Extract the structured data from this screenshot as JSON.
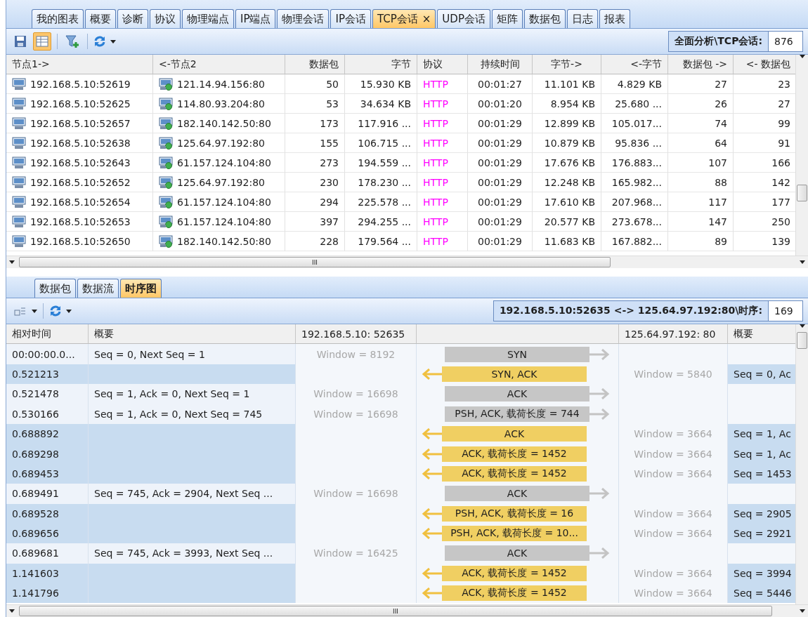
{
  "top_tabs": [
    {
      "label": "我的图表",
      "selected": false
    },
    {
      "label": "概要",
      "selected": false
    },
    {
      "label": "诊断",
      "selected": false
    },
    {
      "label": "协议",
      "selected": false
    },
    {
      "label": "物理端点",
      "selected": false
    },
    {
      "label": "IP端点",
      "selected": false
    },
    {
      "label": "物理会话",
      "selected": false
    },
    {
      "label": "IP会话",
      "selected": false
    },
    {
      "label": "TCP会话",
      "selected": true,
      "close": "×"
    },
    {
      "label": "UDP会话",
      "selected": false
    },
    {
      "label": "矩阵",
      "selected": false
    },
    {
      "label": "数据包",
      "selected": false
    },
    {
      "label": "日志",
      "selected": false
    },
    {
      "label": "报表",
      "selected": false
    }
  ],
  "toolbar": {
    "path_label": "全面分析\\TCP会话:",
    "count": "876"
  },
  "table": {
    "columns": [
      "节点1->",
      "<-节点2",
      "数据包",
      "字节",
      "协议",
      "持续时间",
      "字节->",
      "<-字节",
      "数据包 ->",
      "<- 数据包"
    ],
    "rows": [
      [
        "192.168.5.10:52619",
        "121.14.94.156:80",
        "50",
        "15.930 KB",
        "HTTP",
        "00:01:27",
        "11.101 KB",
        "4.829 KB",
        "27",
        "23"
      ],
      [
        "192.168.5.10:52625",
        "114.80.93.204:80",
        "53",
        "34.634 KB",
        "HTTP",
        "00:01:20",
        "8.954 KB",
        "25.680 ...",
        "26",
        "27"
      ],
      [
        "192.168.5.10:52657",
        "182.140.142.50:80",
        "173",
        "117.916 ...",
        "HTTP",
        "00:01:29",
        "12.899 KB",
        "105.017...",
        "74",
        "99"
      ],
      [
        "192.168.5.10:52638",
        "125.64.97.192:80",
        "155",
        "106.715 ...",
        "HTTP",
        "00:01:29",
        "10.879 KB",
        "95.836 ...",
        "64",
        "91"
      ],
      [
        "192.168.5.10:52643",
        "61.157.124.104:80",
        "273",
        "194.559 ...",
        "HTTP",
        "00:01:29",
        "17.676 KB",
        "176.883...",
        "107",
        "166"
      ],
      [
        "192.168.5.10:52652",
        "125.64.97.192:80",
        "230",
        "178.230 ...",
        "HTTP",
        "00:01:29",
        "12.248 KB",
        "165.982...",
        "88",
        "142"
      ],
      [
        "192.168.5.10:52654",
        "61.157.124.104:80",
        "294",
        "225.578 ...",
        "HTTP",
        "00:01:29",
        "17.610 KB",
        "207.968...",
        "117",
        "177"
      ],
      [
        "192.168.5.10:52653",
        "61.157.124.104:80",
        "397",
        "294.255 ...",
        "HTTP",
        "00:01:29",
        "20.577 KB",
        "273.678...",
        "147",
        "250"
      ],
      [
        "192.168.5.10:52650",
        "182.140.142.50:80",
        "228",
        "179.564 ...",
        "HTTP",
        "00:01:29",
        "11.683 KB",
        "167.882...",
        "89",
        "139"
      ]
    ]
  },
  "bottom_tabs": [
    {
      "label": "数据包",
      "selected": false
    },
    {
      "label": "数据流",
      "selected": false
    },
    {
      "label": "时序图",
      "selected": true
    }
  ],
  "sequence": {
    "path_label": "192.168.5.10:52635 <-> 125.64.97.192:80\\时序:",
    "count": "169",
    "columns": [
      "相对时间",
      "概要",
      "192.168.5.10: 52635",
      "125.64.97.192: 80",
      "概要"
    ],
    "rows": [
      {
        "kind": "out",
        "time": "00:00:00.0...",
        "summary": "Seq = 0, Next Seq = 1",
        "window": "Window = 8192",
        "packet": "SYN"
      },
      {
        "kind": "in",
        "time": "0.521213",
        "summary": "Seq = 0, Ac",
        "window": "Window = 5840",
        "packet": "SYN, ACK"
      },
      {
        "kind": "out",
        "time": "0.521478",
        "summary": "Seq = 1, Ack = 0, Next Seq = 1",
        "window": "Window = 16698",
        "packet": "ACK"
      },
      {
        "kind": "out",
        "time": "0.530166",
        "summary": "Seq = 1, Ack = 0, Next Seq = 745",
        "window": "Window = 16698",
        "packet": "PSH, ACK, 载荷长度 = 744"
      },
      {
        "kind": "in",
        "time": "0.688892",
        "summary": "Seq = 1, Ac",
        "window": "Window = 3664",
        "packet": "ACK"
      },
      {
        "kind": "in",
        "time": "0.689298",
        "summary": "Seq = 1, Ac",
        "window": "Window = 3664",
        "packet": "ACK, 载荷长度 = 1452"
      },
      {
        "kind": "in",
        "time": "0.689453",
        "summary": "Seq = 1453",
        "window": "Window = 3664",
        "packet": "ACK, 载荷长度 = 1452"
      },
      {
        "kind": "out",
        "time": "0.689491",
        "summary": "Seq = 745, Ack = 2904, Next Seq ...",
        "window": "Window = 16698",
        "packet": "ACK"
      },
      {
        "kind": "in",
        "time": "0.689528",
        "summary": "Seq = 2905",
        "window": "Window = 3664",
        "packet": "PSH, ACK, 载荷长度 = 16"
      },
      {
        "kind": "in",
        "time": "0.689656",
        "summary": "Seq = 2921",
        "window": "Window = 3664",
        "packet": "PSH, ACK, 载荷长度 = 10..."
      },
      {
        "kind": "out",
        "time": "0.689681",
        "summary": "Seq = 745, Ack = 3993, Next Seq ...",
        "window": "Window = 16425",
        "packet": "ACK"
      },
      {
        "kind": "in",
        "time": "1.141603",
        "summary": "Seq = 3994",
        "window": "Window = 3664",
        "packet": "ACK, 载荷长度 = 1452"
      },
      {
        "kind": "in",
        "time": "1.141796",
        "summary": "Seq = 5446",
        "window": "Window = 3664",
        "packet": "ACK, 载荷长度 = 1452"
      }
    ]
  },
  "scroll_grips": [
    "III",
    "III"
  ]
}
